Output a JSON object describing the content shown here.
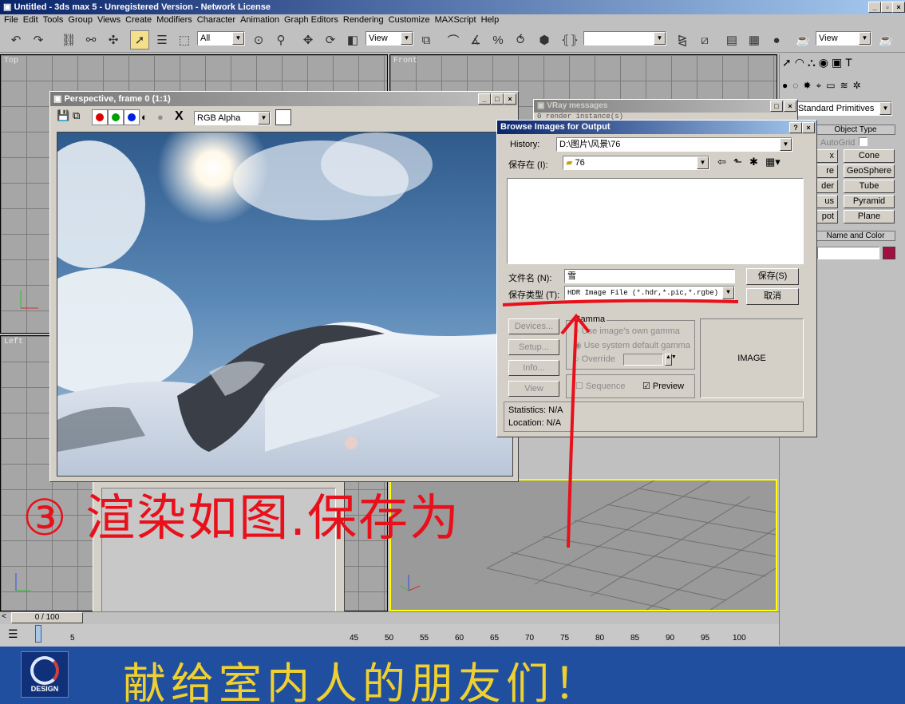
{
  "window": {
    "title": "Untitled - 3ds max 5 - Unregistered Version - Network License"
  },
  "menu": [
    "File",
    "Edit",
    "Tools",
    "Group",
    "Views",
    "Create",
    "Modifiers",
    "Character",
    "Animation",
    "Graph Editors",
    "Rendering",
    "Customize",
    "MAXScript",
    "Help"
  ],
  "toolbar": {
    "selection_filter": "All",
    "ref_coord": "View",
    "named_selection": "",
    "render_view": "View"
  },
  "viewports": {
    "top": "Top",
    "front": "Front",
    "left": "Left"
  },
  "frame_window": {
    "title": "Perspective, frame 0 (1:1)",
    "channel": "RGB Alpha",
    "close_glyph": "X"
  },
  "vray": {
    "title": "VRay messages",
    "line": "0 render instance(s)"
  },
  "cmd_panel": {
    "dropdown": "Standard Primitives",
    "object_type_title": "Object Type",
    "autogrid": "AutoGrid",
    "buttons_left": [
      "x",
      "re",
      "der",
      "us",
      "pot"
    ],
    "buttons_right": [
      "Cone",
      "GeoSphere",
      "Tube",
      "Pyramid",
      "Plane"
    ],
    "name_color_title": "Name and Color"
  },
  "dialog": {
    "title": "Browse Images for Output",
    "history_label": "History:",
    "history_value": "D:\\图片\\风景\\76",
    "save_in_label": "保存在 (I):",
    "save_in_value": "76",
    "filename_label": "文件名 (N):",
    "filename_value": "雪",
    "type_label": "保存类型 (T):",
    "type_value": "HDR Image File (*.hdr,*.pic,*.rgbe)",
    "save_btn": "保存(S)",
    "cancel_btn": "取消",
    "devices_btn": "Devices...",
    "setup_btn": "Setup...",
    "info_btn": "Info...",
    "view_btn": "View",
    "gamma_title": "Gamma",
    "gamma_own": "Use image's own gamma",
    "gamma_default": "Use system default gamma",
    "gamma_override": "Override",
    "sequence_label": "Sequence",
    "preview_label": "Preview",
    "image_label": "IMAGE",
    "statistics": "Statistics:  N/A",
    "location": "Location:  N/A"
  },
  "timeline": {
    "frame_counter": "0 / 100",
    "ticks": [
      "5",
      "45",
      "50",
      "55",
      "60",
      "65",
      "70",
      "75",
      "80",
      "85",
      "90",
      "95",
      "100"
    ]
  },
  "annotations": {
    "step": "③ 渲染如图.保存为",
    "banner": "献给室内人的朋友们！",
    "logo_text": "DESIGN"
  },
  "colors": {
    "titlebar": "#0a246a",
    "annotation": "#e8101a",
    "banner_bg": "#1f4f9e",
    "banner_text": "#f0d030",
    "active_viewport_border": "#ffff00"
  }
}
